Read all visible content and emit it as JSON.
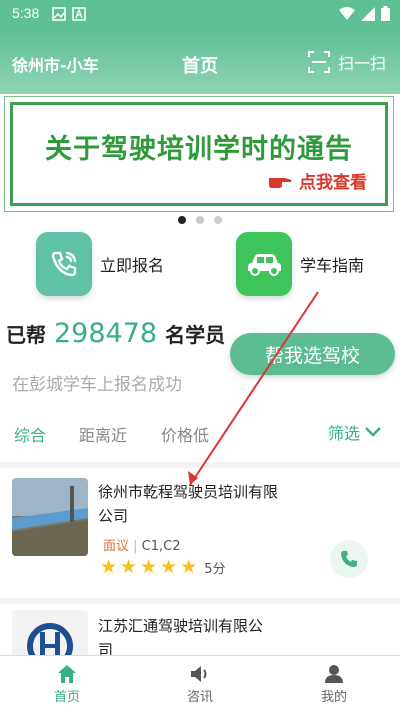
{
  "status": {
    "time": "5:38"
  },
  "header": {
    "city": "徐州市-小车",
    "title": "首页",
    "scan_label": "扫一扫"
  },
  "banner": {
    "text": "关于驾驶培训学时的通告",
    "cta": "点我查看"
  },
  "quick": [
    {
      "label": "立即报名",
      "icon": "phone-icon"
    },
    {
      "label": "学车指南",
      "icon": "car-icon"
    }
  ],
  "stats": {
    "prefix": "已帮",
    "count": "298478",
    "suffix": "名学员",
    "subtitle": "在彭城学车上报名成功"
  },
  "help_button": "帮我选驾校",
  "tabs": [
    "综合",
    "距离近",
    "价格低"
  ],
  "filter_label": "筛选",
  "schools": [
    {
      "name": "徐州市乾程驾驶员培训有限公司",
      "price": "面议",
      "license": "C1,C2",
      "stars": 5,
      "score": "5分"
    },
    {
      "name": "江苏汇通驾驶培训有限公司"
    }
  ],
  "bottom_nav": [
    {
      "label": "首页",
      "icon": "home-icon",
      "active": true
    },
    {
      "label": "咨讯",
      "icon": "speaker-icon",
      "active": false
    },
    {
      "label": "我的",
      "icon": "user-icon",
      "active": false
    }
  ],
  "colors": {
    "accent": "#3aaf82",
    "header": "#5fbf95",
    "banner_green": "#2f9a3a",
    "cta_red": "#d83a2a",
    "star": "#f6c21c"
  }
}
